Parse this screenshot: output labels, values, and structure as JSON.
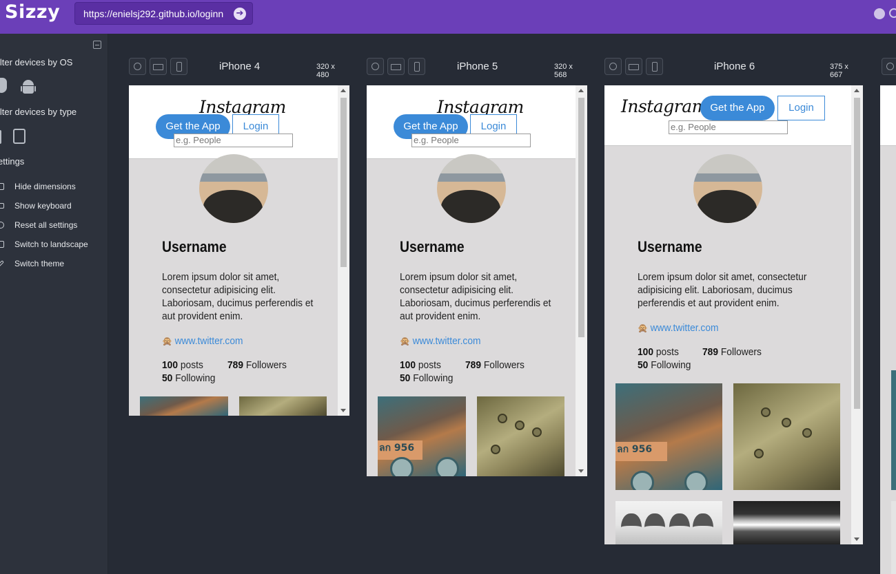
{
  "app": {
    "name": "Sizzy",
    "url": "https://enielsj292.github.io/loginn"
  },
  "sidebar": {
    "filter_os_label": "ilter devices by OS",
    "filter_type_label": "ilter devices by type",
    "settings_label": "ettings",
    "settings_items": [
      {
        "label": "Hide dimensions",
        "icon": "square-icon"
      },
      {
        "label": "Show keyboard",
        "icon": "keyboard-icon"
      },
      {
        "label": "Reset all settings",
        "icon": "refresh-icon"
      },
      {
        "label": "Switch to landscape",
        "icon": "square-icon"
      },
      {
        "label": "Switch theme",
        "icon": "brush-icon"
      }
    ]
  },
  "devices": [
    {
      "name": "iPhone 4",
      "dims": "320 x 480"
    },
    {
      "name": "iPhone 5",
      "dims": "320 x 568"
    },
    {
      "name": "iPhone 6",
      "dims": "375 x 667"
    }
  ],
  "site": {
    "logo": "Instagram",
    "get_app": "Get the App",
    "login": "Login",
    "search_placeholder": "e.g. People",
    "username": "Username",
    "bio": "Lorem ipsum dolor sit amet, consectetur adipisicing elit. Laboriosam, ducimus perferendis et aut provident enim.",
    "bio_lines_narrow": [
      "Lorem ipsum dolor sit amet,",
      "consectetur adipisicing elit.",
      "Laboriosam, ducimus perferendis et",
      "aut provident enim."
    ],
    "bio_lines_wide": [
      "Lorem ipsum dolor sit amet, consectetur",
      "adipisicing elit. Laboriosam, ducimus",
      "perferendis et aut provident enim."
    ],
    "link_emoji": "🙊",
    "link": "www.twitter.com",
    "posts_count": "100",
    "posts_label": "posts",
    "followers_count": "789",
    "followers_label": "Followers",
    "following_count": "50",
    "following_label": "Following",
    "plate_text": "ลก 956"
  },
  "colors": {
    "topbar": "#6b3fb8",
    "sidebar": "#2d323c",
    "canvas": "#262b35",
    "accent": "#3b8ad8"
  }
}
